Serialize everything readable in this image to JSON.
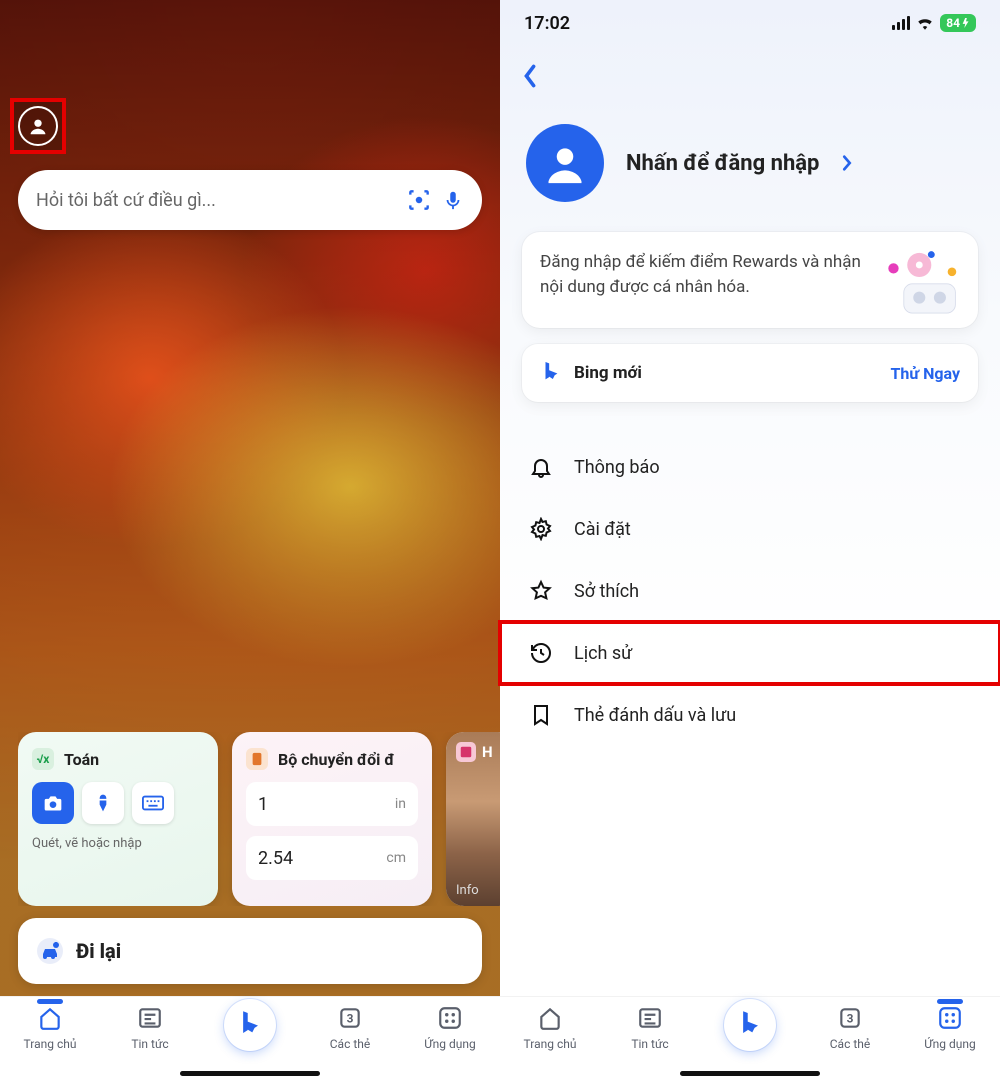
{
  "status": {
    "time": "17:02",
    "battery": "84"
  },
  "left": {
    "search_placeholder": "Hỏi tôi bất cứ điều gì...",
    "cards": {
      "math": {
        "title": "Toán",
        "sub": "Quét, vẽ hoặc nhập",
        "icon_label": "√x"
      },
      "converter": {
        "title": "Bộ chuyển đổi đ",
        "val1": "1",
        "unit1": "in",
        "val2": "2.54",
        "unit2": "cm"
      },
      "image": {
        "title": "H",
        "info": "Info"
      }
    },
    "travel_title": "Đi lại"
  },
  "right": {
    "signin_title": "Nhấn để đăng nhập",
    "promo_text": "Đăng nhập để kiếm điểm Rewards và nhận nội dung được cá nhân hóa.",
    "bing_label": "Bing mới",
    "bing_cta": "Thử Ngay",
    "menu": {
      "notifications": "Thông báo",
      "settings": "Cài đặt",
      "interests": "Sở thích",
      "history": "Lịch sử",
      "bookmarks": "Thẻ đánh dấu và lưu"
    }
  },
  "nav": {
    "home": "Trang chủ",
    "news": "Tin tức",
    "tabs_label": "Các thẻ",
    "tabs_count": "3",
    "apps": "Ứng dụng"
  }
}
